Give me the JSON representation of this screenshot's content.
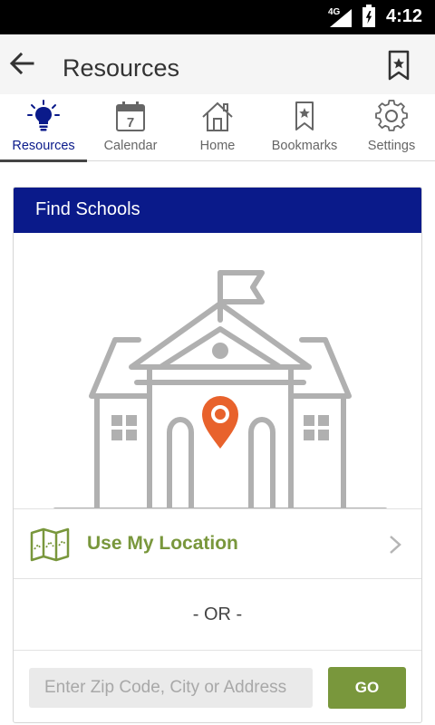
{
  "status_bar": {
    "network": "4G",
    "time": "4:12"
  },
  "app_bar": {
    "title": "Resources"
  },
  "tabs": [
    {
      "label": "Resources",
      "icon": "lightbulb-icon",
      "active": true
    },
    {
      "label": "Calendar",
      "icon": "calendar-icon",
      "day": "7"
    },
    {
      "label": "Home",
      "icon": "home-icon"
    },
    {
      "label": "Bookmarks",
      "icon": "bookmark-icon"
    },
    {
      "label": "Settings",
      "icon": "gear-icon"
    }
  ],
  "card": {
    "title": "Find Schools",
    "illustration": "school-building-with-location-pin",
    "use_location_label": "Use My Location",
    "or_text": "- OR -",
    "search": {
      "placeholder": "Enter Zip Code, City or Address",
      "value": ""
    },
    "go_label": "GO"
  },
  "colors": {
    "brand_blue": "#0a1a8a",
    "accent_green": "#79973c",
    "pin_orange": "#e8622c"
  }
}
